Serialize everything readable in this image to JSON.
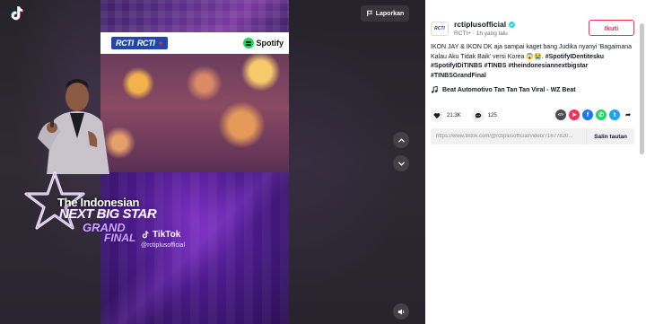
{
  "player": {
    "report_label": "Laporkan",
    "video": {
      "brand_rcti": "RCTI",
      "brand_rcti_plus": "RCTI",
      "brand_spotify": "Spotify",
      "show_line1": "The Indonesian",
      "show_line2": "NEXT BIG STAR",
      "show_line3": "GRAND",
      "show_line4": "FINAL",
      "watermark_name": "TikTok",
      "watermark_handle": "@rctiplusofficial"
    },
    "icons": {
      "logo": "tiktok-logo-icon",
      "report": "flag-icon",
      "prev": "chevron-up-icon",
      "next": "chevron-down-icon",
      "sound": "volume-icon"
    }
  },
  "panel": {
    "author": {
      "avatar_text": "RCTI",
      "username": "rctiplusofficial",
      "subline": "RCTI+ · 1h yang lalu"
    },
    "follow_label": "Ikuti",
    "caption": {
      "text": "IKON JAY & IKON DK aja sampai kaget bang Judika nyanyi 'Bagaimana Kalau Aku Tidak Baik' versi Korea 😱😭.",
      "tags": "#SpotifyIDentitesku #SpotifyIDiTINBS #TINBS #theindonesiannextbigstar #TINBSGrandFinal"
    },
    "music": "Beat Automotivo Tan Tan Tan Viral - WZ Beat",
    "likes": "21.3K",
    "comments": "125",
    "share_icons": [
      {
        "name": "embed-icon",
        "color": "#4b4b52",
        "glyph": "</>"
      },
      {
        "name": "send-icon",
        "color": "#fe2c55",
        "glyph": "➤"
      },
      {
        "name": "facebook-icon",
        "color": "#1877f2",
        "glyph": "f"
      },
      {
        "name": "whatsapp-icon",
        "color": "#25d366",
        "glyph": "✆"
      },
      {
        "name": "twitter-icon",
        "color": "#1da1f2",
        "glyph": "t"
      },
      {
        "name": "share-icon",
        "color": "#ffffff",
        "glyph": "➦"
      }
    ],
    "link_url": "https://www.tiktok.com/@rctiplusofficial/video/71677820...",
    "copy_label": "Salin tautan"
  }
}
